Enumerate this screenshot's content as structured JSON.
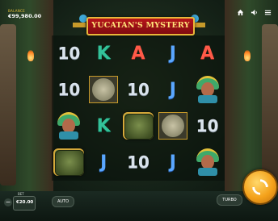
{
  "game": {
    "title": "YUCATAN'S MYSTERY"
  },
  "topbar": {
    "balance_label": "BALANCE",
    "balance_value": "€99,980.00",
    "icons": [
      "home-icon",
      "volume-icon",
      "menu-icon"
    ]
  },
  "reels": [
    [
      "10",
      "10",
      "warrior",
      "headman"
    ],
    [
      "K",
      "stone",
      "K",
      "J"
    ],
    [
      "A",
      "10",
      "headman",
      "10"
    ],
    [
      "J",
      "J",
      "stone",
      "J"
    ],
    [
      "A",
      "warrior",
      "10",
      "warrior"
    ]
  ],
  "bottombar": {
    "bet_label": "BET",
    "bet_value": "€20.00",
    "auto_label": "AUTO",
    "turbo_label": "TURBO",
    "spin_icon": "spin-arrows-icon",
    "minus_label": "−"
  },
  "colors": {
    "banner": "#b8141a",
    "banner_border": "#e8b73a",
    "spin_button": "#f4a11a",
    "K": "#33c29a",
    "A": "#ff5a48",
    "J": "#5aa7ff"
  }
}
